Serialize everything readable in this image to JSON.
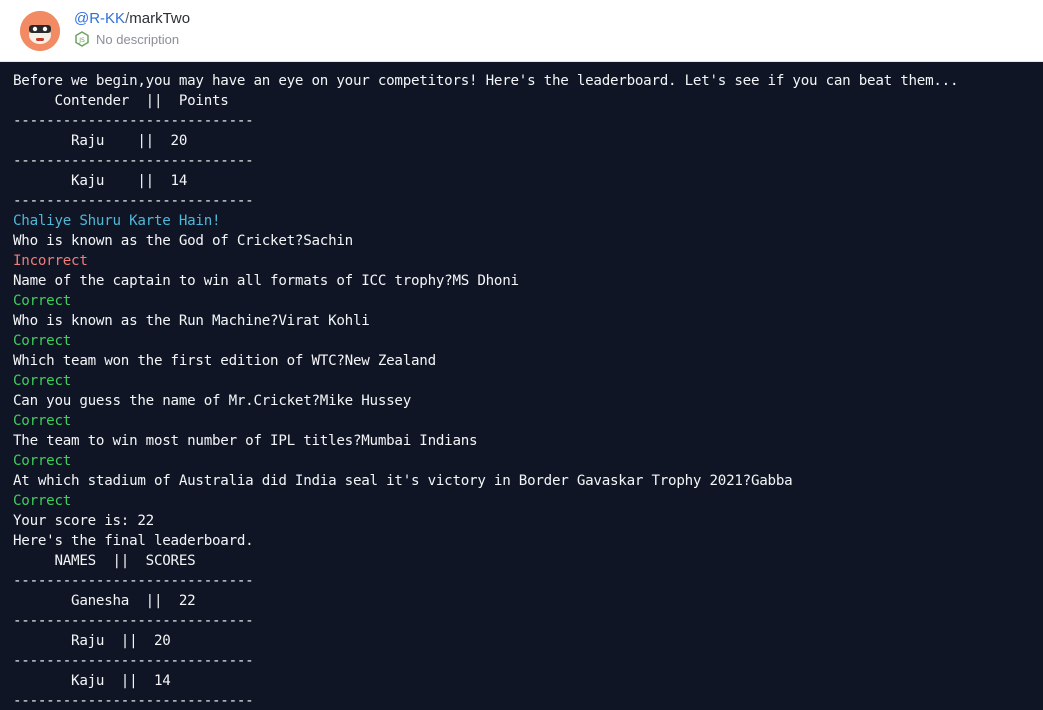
{
  "header": {
    "owner": "@R-KK",
    "separator": "/",
    "repo": "markTwo",
    "description": "No description"
  },
  "console": {
    "lines": [
      {
        "text": "Before we begin,you may have an eye on your competitors! Here's the leaderboard. Let's see if you can beat them...",
        "color": "white"
      },
      {
        "text": "     Contender  ||  Points",
        "color": "white"
      },
      {
        "text": "-----------------------------",
        "color": "white"
      },
      {
        "text": "       Raju    ||  20",
        "color": "white"
      },
      {
        "text": "-----------------------------",
        "color": "white"
      },
      {
        "text": "       Kaju    ||  14",
        "color": "white"
      },
      {
        "text": "-----------------------------",
        "color": "white"
      },
      {
        "text": "Chaliye Shuru Karte Hain!",
        "color": "cyan"
      },
      {
        "text": "Who is known as the God of Cricket?Sachin",
        "color": "white"
      },
      {
        "text": "Incorrect",
        "color": "red"
      },
      {
        "text": "Name of the captain to win all formats of ICC trophy?MS Dhoni",
        "color": "white"
      },
      {
        "text": "Correct",
        "color": "green"
      },
      {
        "text": "Who is known as the Run Machine?Virat Kohli",
        "color": "white"
      },
      {
        "text": "Correct",
        "color": "green"
      },
      {
        "text": "Which team won the first edition of WTC?New Zealand",
        "color": "white"
      },
      {
        "text": "Correct",
        "color": "green"
      },
      {
        "text": "Can you guess the name of Mr.Cricket?Mike Hussey",
        "color": "white"
      },
      {
        "text": "Correct",
        "color": "green"
      },
      {
        "text": "The team to win most number of IPL titles?Mumbai Indians",
        "color": "white"
      },
      {
        "text": "Correct",
        "color": "green"
      },
      {
        "text": "At which stadium of Australia did India seal it's victory in Border Gavaskar Trophy 2021?Gabba",
        "color": "white"
      },
      {
        "text": "Correct",
        "color": "green"
      },
      {
        "text": "Your score is: 22",
        "color": "white"
      },
      {
        "text": "Here's the final leaderboard.",
        "color": "white"
      },
      {
        "text": "     NAMES  ||  SCORES",
        "color": "white"
      },
      {
        "text": "-----------------------------",
        "color": "white"
      },
      {
        "text": "       Ganesha  ||  22",
        "color": "white"
      },
      {
        "text": "-----------------------------",
        "color": "white"
      },
      {
        "text": "       Raju  ||  20",
        "color": "white"
      },
      {
        "text": "-----------------------------",
        "color": "white"
      },
      {
        "text": "       Kaju  ||  14",
        "color": "white"
      },
      {
        "text": "-----------------------------",
        "color": "white"
      }
    ]
  },
  "colors": {
    "console_bg": "#0f1524",
    "console_text": "#f4f5f7",
    "cyan": "#4fb7d8",
    "red": "#f07c7c",
    "green": "#3fcf5c",
    "owner_link": "#2f6fde",
    "avatar_bg": "#f28a63"
  },
  "icons": {
    "avatar": "avatar",
    "language": "nodejs-icon"
  }
}
